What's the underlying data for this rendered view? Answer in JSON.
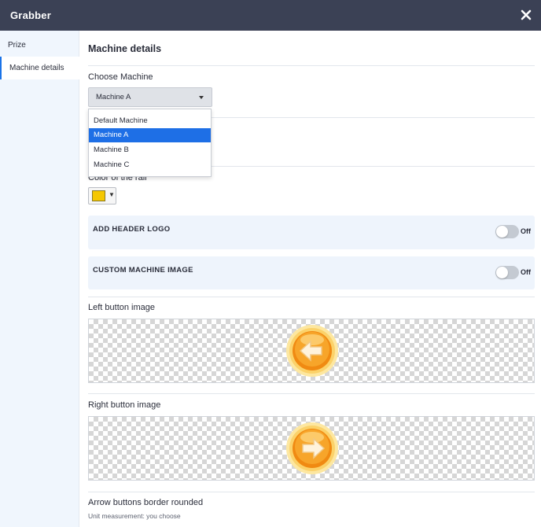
{
  "window": {
    "title": "Grabber",
    "close_icon": "close-icon"
  },
  "sidebar": {
    "items": [
      {
        "label": "Prize",
        "active": false
      },
      {
        "label": "Machine details",
        "active": true
      }
    ],
    "active_color": "#1a73e8"
  },
  "main": {
    "section_title": "Machine details",
    "choose_machine": {
      "label": "Choose Machine",
      "selected_value": "Machine A",
      "options": [
        "Default Machine",
        "Machine A",
        "Machine B",
        "Machine C"
      ],
      "highlighted_index": 1
    },
    "rail_color": {
      "label": "Color of the rail",
      "value": "#f5c700"
    },
    "header_logo": {
      "label": "ADD HEADER LOGO",
      "toggle_text": "Off",
      "enabled": false
    },
    "custom_machine_image": {
      "label": "CUSTOM MACHINE IMAGE",
      "toggle_text": "Off",
      "enabled": false
    },
    "left_button_image": {
      "label": "Left button image",
      "icon": "left-arrow-button-icon"
    },
    "right_button_image": {
      "label": "Right button image",
      "icon": "right-arrow-button-icon"
    },
    "arrow_border": {
      "label": "Arrow buttons border rounded",
      "sublabel": "Unit measurement: you choose"
    }
  },
  "colors": {
    "titlebar": "#3b4155",
    "sidebar_bg": "#f0f6fd",
    "panel_bg": "#eef4fc",
    "dropdown_highlight": "#1e6fe6",
    "button_orange": "#f39a1a"
  }
}
